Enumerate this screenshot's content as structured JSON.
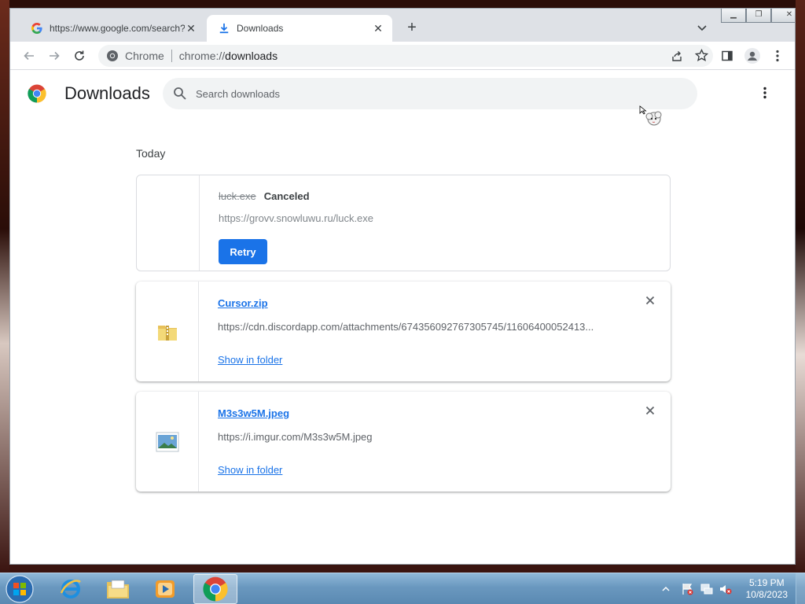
{
  "browser": {
    "tabs": [
      {
        "title": "https://www.google.com/search?",
        "active": false,
        "favicon": "google-g-icon"
      },
      {
        "title": "Downloads",
        "active": true,
        "favicon": "download-icon"
      }
    ],
    "new_tab_label": "+",
    "omnibox": {
      "site_label": "Chrome",
      "url_scheme": "chrome://",
      "url_path": "downloads"
    }
  },
  "downloads_page": {
    "title": "Downloads",
    "search_placeholder": "Search downloads",
    "section_label": "Today",
    "items": [
      {
        "file_name": "luck.exe",
        "status": "Canceled",
        "url": "https://grovv.snowluwu.ru/luck.exe",
        "action_label": "Retry",
        "icon": "none"
      },
      {
        "file_name": "Cursor.zip",
        "url": "https://cdn.discordapp.com/attachments/674356092767305745/11606400052413...",
        "action_label": "Show in folder",
        "icon": "zip-folder-icon"
      },
      {
        "file_name": "M3s3w5M.jpeg",
        "url": "https://i.imgur.com/M3s3w5M.jpeg",
        "action_label": "Show in folder",
        "icon": "image-file-icon"
      }
    ]
  },
  "taskbar": {
    "apps": [
      "internet-explorer-icon",
      "file-explorer-icon",
      "media-player-icon",
      "chrome-icon"
    ],
    "active_app": "chrome-icon",
    "clock_time": "5:19 PM",
    "clock_date": "10/8/2023"
  },
  "colors": {
    "accent": "#1a73e8",
    "tabstrip": "#dee1e6",
    "omnibox_bg": "#f1f3f4"
  }
}
